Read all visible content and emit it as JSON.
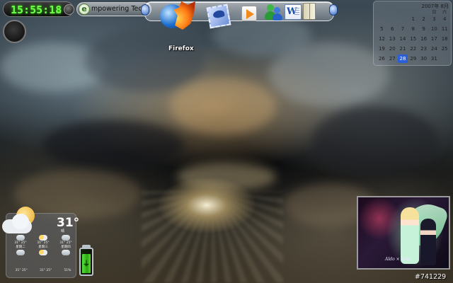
{
  "clock": {
    "time": "15:55:18",
    "ampm": "PM"
  },
  "brand": {
    "logo_letter": "e",
    "text": "mpowering Tech"
  },
  "dock": {
    "items": [
      {
        "label": "Firefox",
        "icon": "firefox-icon"
      },
      {
        "label": "",
        "icon": "mail-icon"
      },
      {
        "label": "",
        "icon": "media-player-icon"
      },
      {
        "label": "",
        "icon": "messenger-icon"
      },
      {
        "label": "",
        "icon": "word-icon"
      },
      {
        "label": "",
        "icon": "folder-icon"
      }
    ]
  },
  "calendar": {
    "header": "2007年 8月",
    "weekdays": [
      "",
      "",
      "",
      "",
      "",
      "日",
      "六"
    ],
    "rows": [
      [
        "",
        "",
        "",
        "1",
        "2",
        "3",
        "4"
      ],
      [
        "5",
        "6",
        "7",
        "8",
        "9",
        "10",
        "11"
      ],
      [
        "12",
        "13",
        "14",
        "15",
        "16",
        "17",
        "18"
      ],
      [
        "19",
        "20",
        "21",
        "22",
        "23",
        "24",
        "25"
      ],
      [
        "26",
        "27",
        "28",
        "29",
        "30",
        "31",
        ""
      ]
    ],
    "today": "28",
    "accent": "#2b5fd9"
  },
  "weather": {
    "temp": "31°",
    "condition": "晴",
    "days": [
      {
        "name": "星期二",
        "hi_lo": "31° 25°",
        "icon": "cloudy"
      },
      {
        "name": "星期三",
        "hi_lo": "31° 25°",
        "icon": "partly-sunny"
      },
      {
        "name": "星期四",
        "hi_lo": "31° 25°",
        "icon": "cloudy"
      }
    ],
    "footer": [
      "31° 25°",
      "31° 25°",
      "51%"
    ]
  },
  "battery": {
    "level": 0.85,
    "fill_color": "#3cc21f"
  },
  "photo": {
    "signature": "Aldo × Yuki",
    "id": "#741229"
  }
}
